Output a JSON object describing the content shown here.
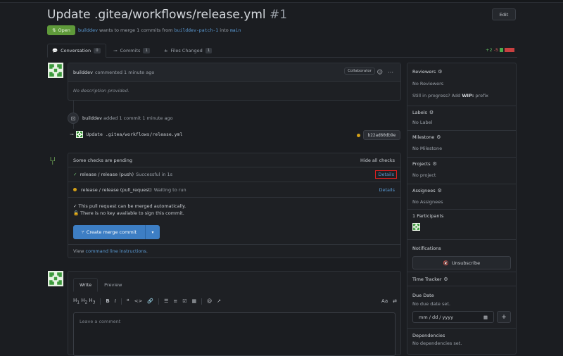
{
  "pr": {
    "title": "Update .gitea/workflows/release.yml",
    "number": "#1",
    "edit_label": "Edit",
    "status": "Open",
    "author": "builddev",
    "merge_text": "wants to merge 1 commits from",
    "source_branch": "builddev-patch-1",
    "into_text": "into",
    "target_branch": "main"
  },
  "tabs": [
    {
      "label": "Conversation",
      "count": "0"
    },
    {
      "label": "Commits",
      "count": "1"
    },
    {
      "label": "Files Changed",
      "count": "1"
    }
  ],
  "diffstat": {
    "additions": "+2",
    "deletions": "-5"
  },
  "comment": {
    "author": "builddev",
    "meta": "commented 1 minute ago",
    "badge": "Collaborator",
    "body": "No description provided."
  },
  "commit_event": {
    "author": "builddev",
    "meta": "added 1 commit 1 minute ago",
    "message": "Update .gitea/workflows/release.yml",
    "sha": "b22ad60db9e"
  },
  "checks": {
    "header": "Some checks are pending",
    "hide_label": "Hide all checks",
    "items": [
      {
        "name": "release / release (push)",
        "status": "Successful in 1s",
        "details": "Details",
        "state": "success"
      },
      {
        "name": "release / release (pull_request)",
        "status": "Waiting to run",
        "details": "Details",
        "state": "pending"
      }
    ],
    "merge_info_1": "This pull request can be merged automatically.",
    "merge_info_2": "There is no key available to sign this commit.",
    "merge_button": "Create merge commit",
    "view_prefix": "View",
    "cli_link": "command line instructions",
    "view_suffix": "."
  },
  "editor": {
    "tab_write": "Write",
    "tab_preview": "Preview",
    "placeholder": "Leave a comment"
  },
  "sidebar": {
    "reviewers": {
      "label": "Reviewers",
      "value": "No Reviewers",
      "wip_prefix": "Still in progress? Add",
      "wip": "WIP:",
      "wip_suffix": "prefix"
    },
    "labels": {
      "label": "Labels",
      "value": "No Label"
    },
    "milestone": {
      "label": "Milestone",
      "value": "No Milestone"
    },
    "projects": {
      "label": "Projects",
      "value": "No project"
    },
    "assignees": {
      "label": "Assignees",
      "value": "No Assignees"
    },
    "participants": {
      "label": "1 Participants"
    },
    "notifications": {
      "label": "Notifications",
      "button": "Unsubscribe"
    },
    "time_tracker": {
      "label": "Time Tracker"
    },
    "due_date": {
      "label": "Due Date",
      "value": "No due date set.",
      "placeholder": "mm / dd / yyyy"
    },
    "dependencies": {
      "label": "Dependencies",
      "value": "No dependencies set."
    }
  },
  "colors": {
    "accent": "#3d7ec4",
    "open": "#5f9a3a",
    "success": "#6fbf6f",
    "pending": "#d4a017",
    "link": "#5b9bd5"
  }
}
